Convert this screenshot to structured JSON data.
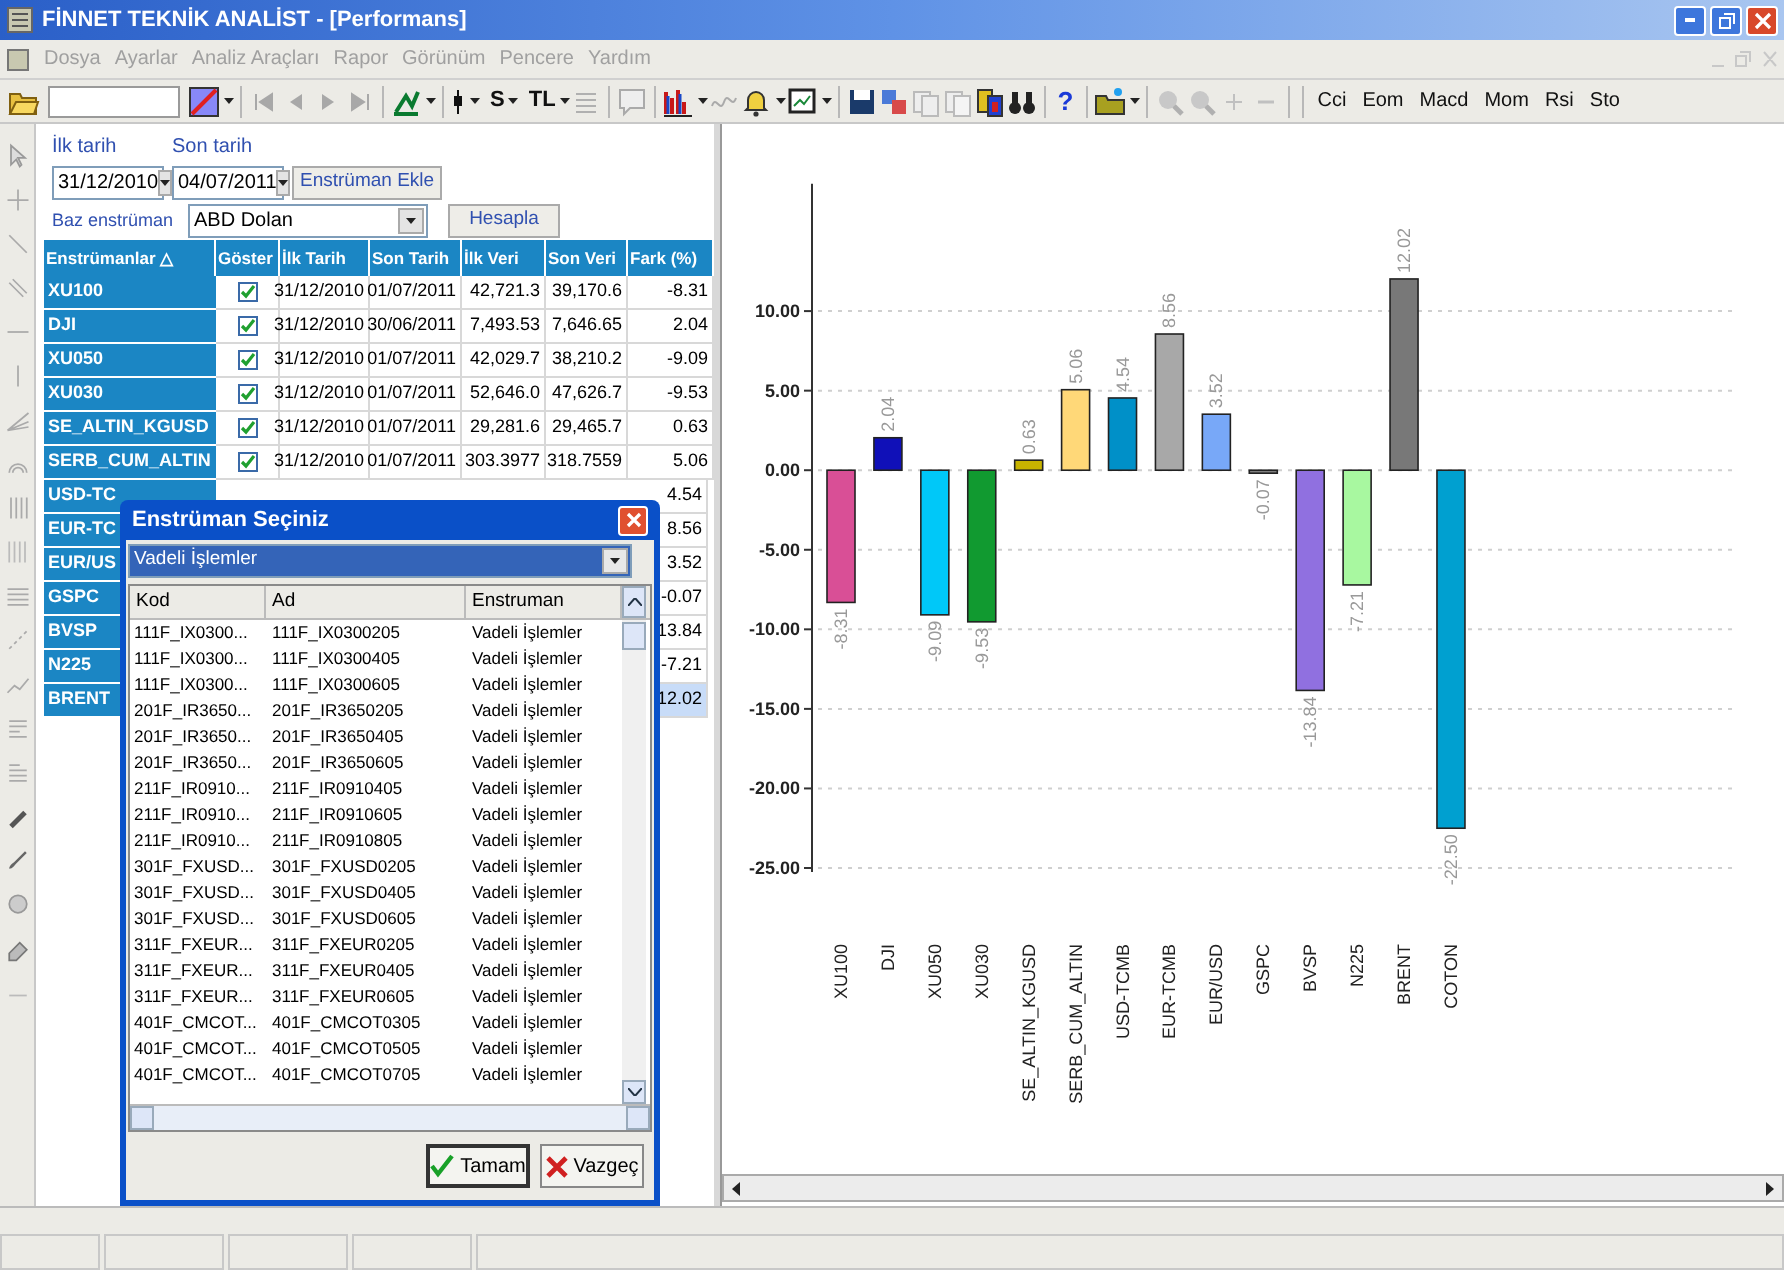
{
  "window": {
    "title": "FİNNET TEKNİK ANALİST - [Performans]"
  },
  "menu": [
    {
      "label": "Dosya",
      "disabled": true
    },
    {
      "label": "Ayarlar",
      "disabled": true
    },
    {
      "label": "Analiz Araçları",
      "disabled": true
    },
    {
      "label": "Rapor",
      "disabled": true
    },
    {
      "label": "Görünüm",
      "disabled": true
    },
    {
      "label": "Pencere",
      "disabled": true
    },
    {
      "label": "Yardım",
      "disabled": true
    }
  ],
  "toolbar": {
    "currency_buttons": [
      "S",
      "TL"
    ],
    "help": "?",
    "indicators": [
      "Cci",
      "Eom",
      "Macd",
      "Mom",
      "Rsi",
      "Sto"
    ]
  },
  "form": {
    "start_label": "İlk tarih",
    "start_value": "31/12/2010",
    "end_label": "Son tarih",
    "end_value": "04/07/2011",
    "add_button": "Enstrüman Ekle",
    "base_label": "Baz enstrüman",
    "base_value": "ABD Dolan",
    "calc_button": "Hesapla"
  },
  "table": {
    "columns": [
      "Enstrümanlar △",
      "Göster",
      "İlk Tarih",
      "Son Tarih",
      "İlk Veri",
      "Son Veri",
      "Fark (%)"
    ],
    "rows": [
      {
        "kind": "full",
        "name": "XU100",
        "checked": true,
        "first_date": "31/12/2010",
        "last_date": "01/07/2011",
        "first_value": "42,721.3",
        "last_value": "39,170.6",
        "diff": "-8.31",
        "selected": false
      },
      {
        "kind": "full",
        "name": "DJI",
        "checked": true,
        "first_date": "31/12/2010",
        "last_date": "30/06/2011",
        "first_value": "7,493.53",
        "last_value": "7,646.65",
        "diff": "2.04",
        "selected": false
      },
      {
        "kind": "full",
        "name": "XU050",
        "checked": true,
        "first_date": "31/12/2010",
        "last_date": "01/07/2011",
        "first_value": "42,029.7",
        "last_value": "38,210.2",
        "diff": "-9.09",
        "selected": false
      },
      {
        "kind": "full",
        "name": "XU030",
        "checked": true,
        "first_date": "31/12/2010",
        "last_date": "01/07/2011",
        "first_value": "52,646.0",
        "last_value": "47,626.7",
        "diff": "-9.53",
        "selected": false
      },
      {
        "kind": "full",
        "name": "SE_ALTIN_KGUSD",
        "checked": true,
        "first_date": "31/12/2010",
        "last_date": "01/07/2011",
        "first_value": "29,281.6",
        "last_value": "29,465.7",
        "diff": "0.63",
        "selected": false
      },
      {
        "kind": "full",
        "name": "SERB_CUM_ALTIN",
        "checked": true,
        "first_date": "31/12/2010",
        "last_date": "01/07/2011",
        "first_value": "303.3977",
        "last_value": "318.7559",
        "diff": "5.06",
        "selected": false
      },
      {
        "kind": "partial",
        "name": "USD-TC",
        "diff": "4.54",
        "selected": false
      },
      {
        "kind": "partial",
        "name": "EUR-TC",
        "diff": "8.56",
        "selected": false
      },
      {
        "kind": "partial",
        "name": "EUR/US",
        "diff": "3.52",
        "selected": false
      },
      {
        "kind": "partial",
        "name": "GSPC",
        "diff": "-0.07",
        "selected": false
      },
      {
        "kind": "partial",
        "name": "BVSP",
        "diff": "13.84",
        "selected": false
      },
      {
        "kind": "partial",
        "name": "N225",
        "diff": "-7.21",
        "selected": false
      },
      {
        "kind": "partial",
        "name": "BRENT",
        "diff": "12.02",
        "selected": true
      }
    ]
  },
  "dialog": {
    "title": "Enstrüman Seçiniz",
    "filter_value": "Vadeli İşlemler",
    "columns": [
      "Kod",
      "Ad",
      "Enstruman"
    ],
    "rows": [
      {
        "code": "111F_IX0300...",
        "name": "111F_IX0300205",
        "type": "Vadeli İşlemler"
      },
      {
        "code": "111F_IX0300...",
        "name": "111F_IX0300405",
        "type": "Vadeli İşlemler"
      },
      {
        "code": "111F_IX0300...",
        "name": "111F_IX0300605",
        "type": "Vadeli İşlemler"
      },
      {
        "code": "201F_IR3650...",
        "name": "201F_IR3650205",
        "type": "Vadeli İşlemler"
      },
      {
        "code": "201F_IR3650...",
        "name": "201F_IR3650405",
        "type": "Vadeli İşlemler"
      },
      {
        "code": "201F_IR3650...",
        "name": "201F_IR3650605",
        "type": "Vadeli İşlemler"
      },
      {
        "code": "211F_IR0910...",
        "name": "211F_IR0910405",
        "type": "Vadeli İşlemler"
      },
      {
        "code": "211F_IR0910...",
        "name": "211F_IR0910605",
        "type": "Vadeli İşlemler"
      },
      {
        "code": "211F_IR0910...",
        "name": "211F_IR0910805",
        "type": "Vadeli İşlemler"
      },
      {
        "code": "301F_FXUSD...",
        "name": "301F_FXUSD0205",
        "type": "Vadeli İşlemler"
      },
      {
        "code": "301F_FXUSD...",
        "name": "301F_FXUSD0405",
        "type": "Vadeli İşlemler"
      },
      {
        "code": "301F_FXUSD...",
        "name": "301F_FXUSD0605",
        "type": "Vadeli İşlemler"
      },
      {
        "code": "311F_FXEUR...",
        "name": "311F_FXEUR0205",
        "type": "Vadeli İşlemler"
      },
      {
        "code": "311F_FXEUR...",
        "name": "311F_FXEUR0405",
        "type": "Vadeli İşlemler"
      },
      {
        "code": "311F_FXEUR...",
        "name": "311F_FXEUR0605",
        "type": "Vadeli İşlemler"
      },
      {
        "code": "401F_CMCOT...",
        "name": "401F_CMCOT0305",
        "type": "Vadeli İşlemler"
      },
      {
        "code": "401F_CMCOT...",
        "name": "401F_CMCOT0505",
        "type": "Vadeli İşlemler"
      },
      {
        "code": "401F_CMCOT...",
        "name": "401F_CMCOT0705",
        "type": "Vadeli İşlemler"
      }
    ],
    "ok_button": "Tamam",
    "cancel_button": "Vazgeç"
  },
  "chart": {
    "chart_data": {
      "type": "bar",
      "categories": [
        "XU100",
        "DJI",
        "XU050",
        "XU030",
        "SE_ALTIN_KGUSD",
        "SERB_CUM_ALTIN",
        "USD-TCMB",
        "EUR-TCMB",
        "EUR/USD",
        "GSPC",
        "BVSP",
        "N225",
        "BRENT",
        "COTON"
      ],
      "series": [
        {
          "values": [
            -8.31,
            2.04,
            -9.09,
            -9.53,
            0.63,
            5.06,
            4.54,
            8.56,
            3.52,
            -0.07,
            -13.84,
            -7.21,
            12.02,
            -22.5
          ]
        }
      ],
      "colors": [
        "#d94f96",
        "#1010b8",
        "#00c8f8",
        "#119a30",
        "#c8b400",
        "#ffd878",
        "#0090c8",
        "#a8a8a8",
        "#78a8f8",
        "#808080",
        "#9070e0",
        "#a8f8a0",
        "#787878",
        "#00a0d0"
      ],
      "yticks": [
        {
          "value": 10,
          "label": "10.00"
        },
        {
          "value": 5,
          "label": "5.00"
        },
        {
          "value": 0,
          "label": "0.00"
        },
        {
          "value": -5,
          "label": "-5.00"
        },
        {
          "value": -10,
          "label": "-10.00"
        },
        {
          "value": -15,
          "label": "-15.00"
        },
        {
          "value": -20,
          "label": "-20.00"
        },
        {
          "value": -25,
          "label": "-25.00"
        }
      ],
      "ylim": [
        -25,
        18
      ],
      "grid": true,
      "value_labels": [
        "-8.31",
        "2.04",
        "-9.09",
        "-9.53",
        "0.63",
        "5.06",
        "4.54",
        "8.56",
        "3.52",
        "-0.07",
        "-13.84",
        "-7.21",
        "12.02",
        "-22.50"
      ]
    }
  }
}
